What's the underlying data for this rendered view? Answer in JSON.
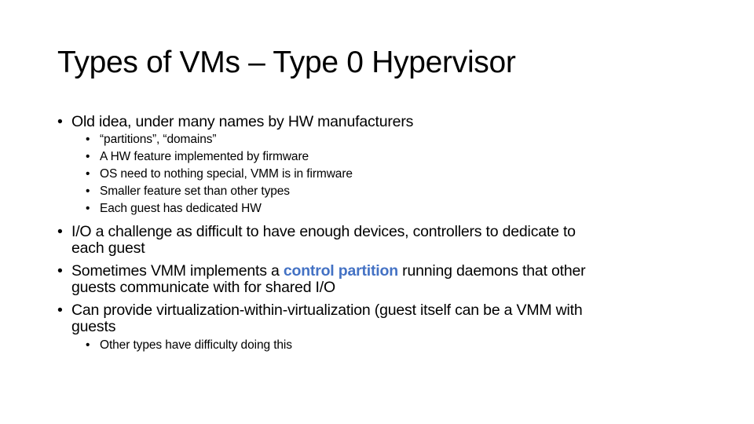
{
  "slide": {
    "title": "Types of VMs – Type 0 Hypervisor",
    "bullet_char": "•",
    "accent_color": "#4472C4",
    "bullets": [
      {
        "text": "Old idea, under many names by HW manufacturers",
        "sub": [
          "“partitions”, “domains”",
          "A HW feature implemented by firmware",
          "OS need to nothing special, VMM is in firmware",
          "Smaller feature set than other types",
          "Each guest has dedicated HW"
        ]
      },
      {
        "line1": "I/O a challenge as difficult to have enough devices, controllers to dedicate to",
        "line2": "each guest"
      },
      {
        "pre": "Sometimes VMM implements a ",
        "highlight": "control partition",
        "post": " running daemons that other",
        "line2": "guests communicate with for shared I/O"
      },
      {
        "line1": "Can provide virtualization-within-virtualization (guest itself can be a VMM with",
        "line2": "guests",
        "sub": [
          "Other types have difficulty doing this"
        ]
      }
    ]
  }
}
